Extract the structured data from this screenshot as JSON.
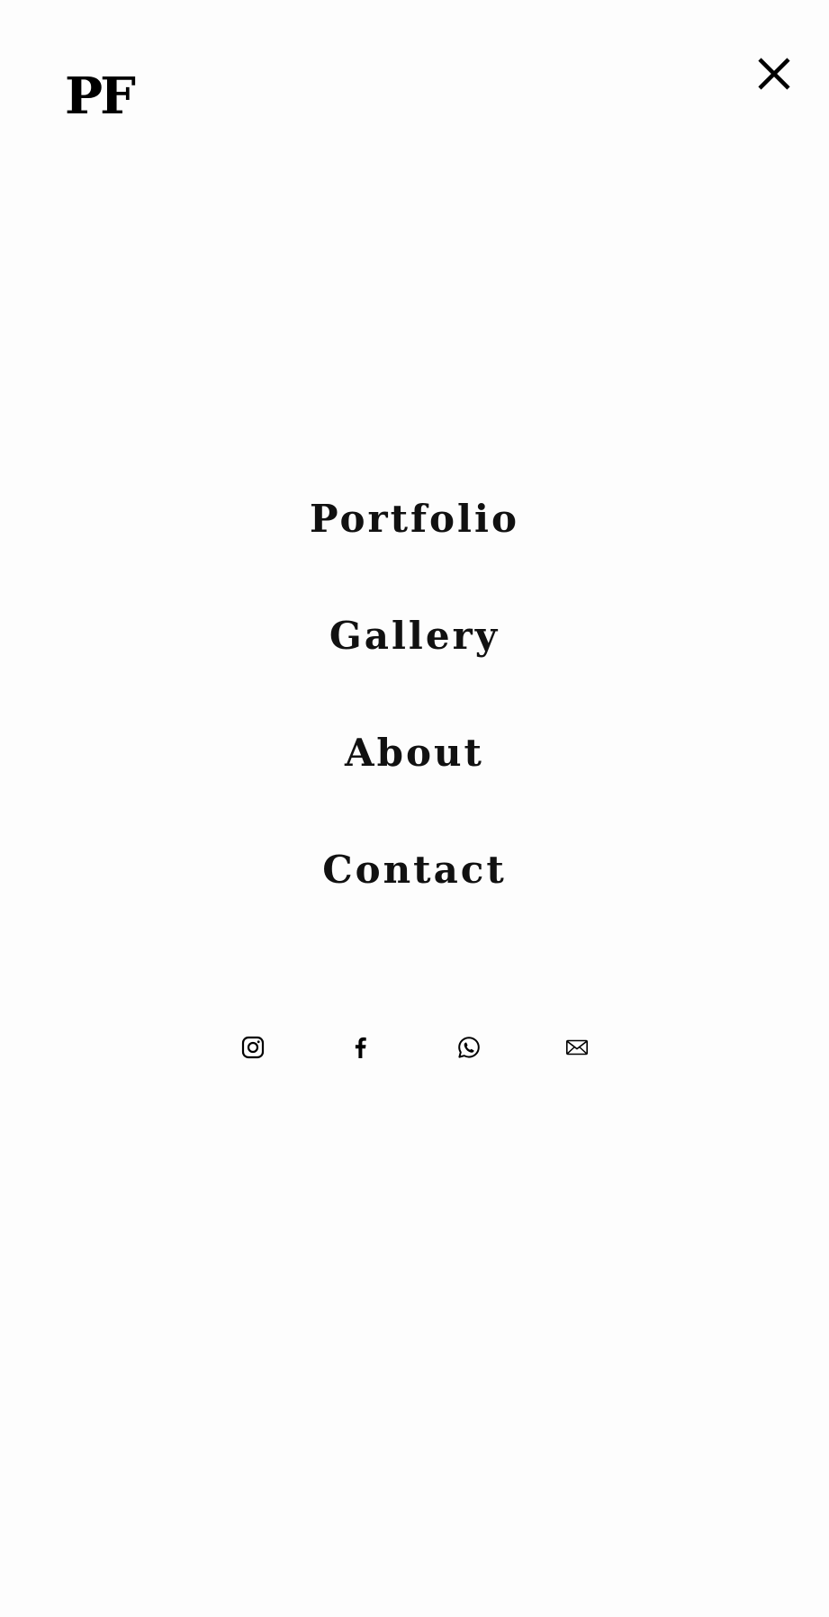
{
  "header": {
    "logo_text": "PF",
    "close_icon": "close-icon"
  },
  "nav": {
    "items": [
      {
        "label": "Portfolio"
      },
      {
        "label": "Gallery"
      },
      {
        "label": "About"
      },
      {
        "label": "Contact"
      }
    ]
  },
  "social": {
    "icons": [
      "instagram-icon",
      "facebook-icon",
      "whatsapp-icon",
      "mail-icon"
    ]
  },
  "colors": {
    "background": "#fdfdfd",
    "text": "#000000"
  }
}
